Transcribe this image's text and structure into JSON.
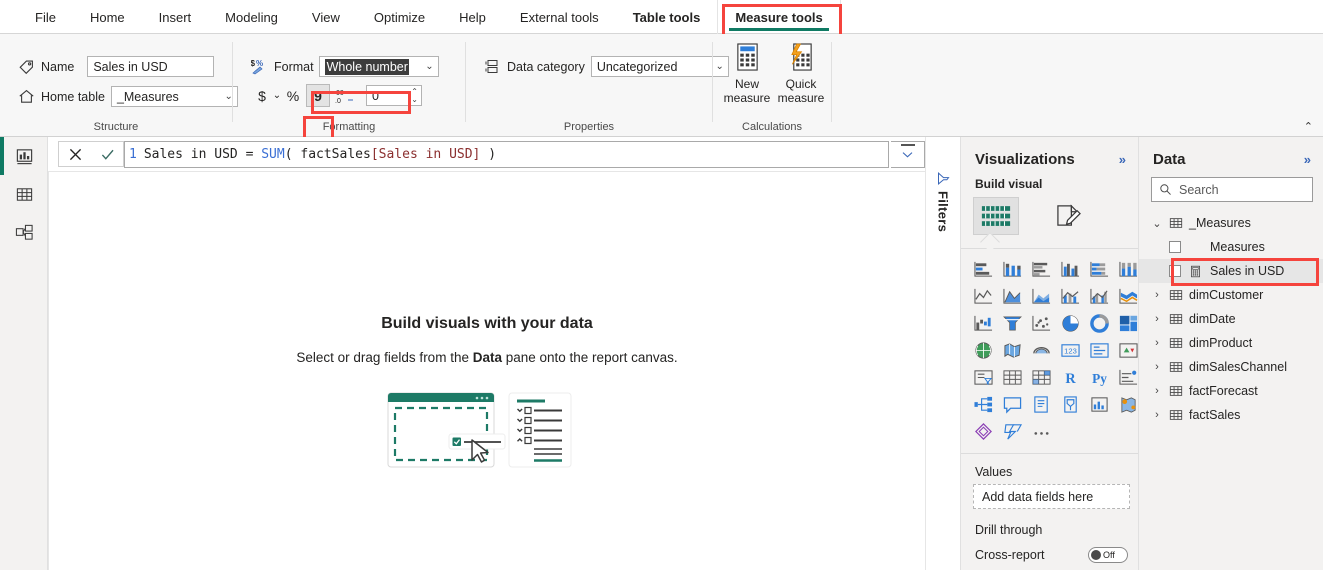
{
  "ribbon": {
    "tabs": [
      {
        "label": "File",
        "active": false,
        "bold": false
      },
      {
        "label": "Home",
        "active": false,
        "bold": false
      },
      {
        "label": "Insert",
        "active": false,
        "bold": false
      },
      {
        "label": "Modeling",
        "active": false,
        "bold": false
      },
      {
        "label": "View",
        "active": false,
        "bold": false
      },
      {
        "label": "Optimize",
        "active": false,
        "bold": false
      },
      {
        "label": "Help",
        "active": false,
        "bold": false
      },
      {
        "label": "External tools",
        "active": false,
        "bold": false
      },
      {
        "label": "Table tools",
        "active": false,
        "bold": true
      },
      {
        "label": "Measure tools",
        "active": true,
        "bold": true
      }
    ],
    "collapse_chevron": "⌃",
    "groups": {
      "structure": {
        "label": "Structure",
        "name_label": "Name",
        "name_value": "Sales in USD",
        "home_table_label": "Home table",
        "home_table_value": "_Measures"
      },
      "formatting": {
        "label": "Formatting",
        "format_label": "Format",
        "format_value": "Whole number",
        "currency_symbol": "$",
        "percent_symbol": "%",
        "comma_symbol": "9",
        "decimal_icon": "00",
        "decimal_places_value": "0"
      },
      "properties": {
        "label": "Properties",
        "data_category_label": "Data category",
        "data_category_value": "Uncategorized"
      },
      "calculations": {
        "label": "Calculations",
        "new_measure_line1": "New",
        "new_measure_line2": "measure",
        "quick_measure_line1": "Quick",
        "quick_measure_line2": "measure"
      }
    }
  },
  "rail": {
    "items": [
      {
        "name": "report-view",
        "selected": true
      },
      {
        "name": "table-view",
        "selected": false
      },
      {
        "name": "model-view",
        "selected": false
      }
    ]
  },
  "formula_bar": {
    "cancel_glyph": "✕",
    "accept_glyph": "✓",
    "line_number": "1",
    "tokens": [
      {
        "t": "Sales in USD = ",
        "k": "plain"
      },
      {
        "t": "SUM",
        "k": "function"
      },
      {
        "t": "( factSales",
        "k": "plain"
      },
      {
        "t": "[Sales in USD]",
        "k": "column"
      },
      {
        "t": " )",
        "k": "plain"
      }
    ],
    "expand_glyph": "⌄"
  },
  "canvas": {
    "title": "Build visuals with your data",
    "subtitle_pre": "Select or drag fields from the ",
    "subtitle_bold": "Data",
    "subtitle_post": " pane onto the report canvas."
  },
  "filters": {
    "label": "Filters"
  },
  "visualizations": {
    "title": "Visualizations",
    "collapse_glyph": "»",
    "build_visual_label": "Build visual",
    "build_buttons": [
      {
        "name": "build-visual-fields-button",
        "selected": true
      },
      {
        "name": "build-visual-format-button",
        "selected": false
      }
    ],
    "icons": [
      "stacked-bar-chart",
      "stacked-column-chart",
      "clustered-bar-chart",
      "clustered-column-chart",
      "100-stacked-bar-chart",
      "100-stacked-column-chart",
      "line-chart",
      "area-chart",
      "stacked-area-chart",
      "line-and-stacked-column-chart",
      "line-and-clustered-column-chart",
      "ribbon-chart",
      "waterfall-chart",
      "funnel-chart",
      "scatter-chart",
      "pie-chart",
      "donut-chart",
      "treemap",
      "map",
      "filled-map",
      "arcgis-map",
      "card",
      "multi-row-card",
      "kpi",
      "slicer",
      "table",
      "matrix",
      "r-script-visual",
      "python-visual",
      "key-influencers",
      "decomposition-tree",
      "q-and-a",
      "smart-narrative",
      "paginated-report",
      "power-apps",
      "azure-map",
      "get-more-visuals",
      "power-automate",
      "more-options"
    ],
    "values_label": "Values",
    "values_placeholder": "Add data fields here",
    "drill_through_label": "Drill through",
    "cross_report_label": "Cross-report",
    "cross_report_state": "Off"
  },
  "data_pane": {
    "title": "Data",
    "collapse_glyph": "»",
    "search_placeholder": "Search",
    "tree": [
      {
        "label": "_Measures",
        "type": "table",
        "expanded": true,
        "indent": 0,
        "selected": false
      },
      {
        "label": "Measures",
        "type": "field-plain",
        "expanded": null,
        "indent": 1,
        "selected": false
      },
      {
        "label": "Sales in USD",
        "type": "measure",
        "expanded": null,
        "indent": 1,
        "selected": true
      },
      {
        "label": "dimCustomer",
        "type": "table",
        "expanded": false,
        "indent": 0,
        "selected": false
      },
      {
        "label": "dimDate",
        "type": "table",
        "expanded": false,
        "indent": 0,
        "selected": false
      },
      {
        "label": "dimProduct",
        "type": "table",
        "expanded": false,
        "indent": 0,
        "selected": false
      },
      {
        "label": "dimSalesChannel",
        "type": "table",
        "expanded": false,
        "indent": 0,
        "selected": false
      },
      {
        "label": "factForecast",
        "type": "table",
        "expanded": false,
        "indent": 0,
        "selected": false
      },
      {
        "label": "factSales",
        "type": "table",
        "expanded": false,
        "indent": 0,
        "selected": false
      }
    ]
  },
  "annotations": {
    "color": "#f5443d",
    "boxes": [
      "measure-tools-tab",
      "format-dropdown-value",
      "thousands-separator-button",
      "data-pane-sales-in-usd"
    ]
  },
  "theme": {
    "accent_teal": "#0f7a63",
    "annotation_red": "#f5443d",
    "viz_blue": "#2f7ed8",
    "pane_bg": "#f3f2f1"
  }
}
